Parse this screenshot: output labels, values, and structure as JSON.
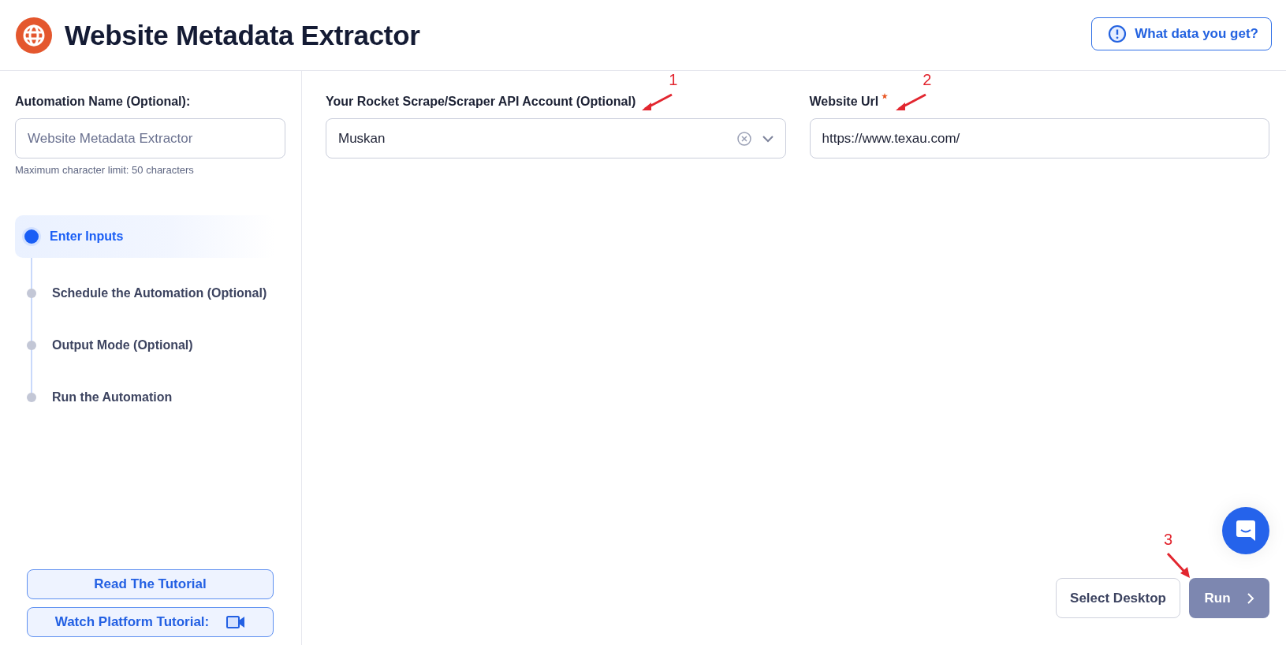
{
  "header": {
    "title": "Website Metadata Extractor",
    "help_button": "What data you get?"
  },
  "sidebar": {
    "name_label": "Automation Name (Optional):",
    "name_placeholder": "Website Metadata Extractor",
    "name_hint": "Maximum character limit: 50 characters",
    "steps": [
      {
        "label": "Enter Inputs",
        "selected": true
      },
      {
        "label": "Schedule the Automation (Optional)",
        "selected": false
      },
      {
        "label": "Output Mode (Optional)",
        "selected": false
      },
      {
        "label": "Run the Automation",
        "selected": false
      }
    ],
    "buttons": [
      {
        "label": "Read The Tutorial",
        "kind": "text"
      },
      {
        "label": "Watch Platform Tutorial:",
        "kind": "video"
      }
    ]
  },
  "fields": [
    {
      "kind": "select",
      "label": "Your Rocket Scrape/Scraper API Account (Optional)",
      "required": false,
      "value": "Muskan",
      "annotation": "1"
    },
    {
      "kind": "text",
      "label": "Website Url",
      "required": true,
      "value": "https://www.texau.com/",
      "annotation": "2"
    }
  ],
  "footer": {
    "secondary_button": "Select Desktop",
    "run_button": {
      "label": "Run",
      "disabled": true,
      "annotation": "3"
    }
  }
}
